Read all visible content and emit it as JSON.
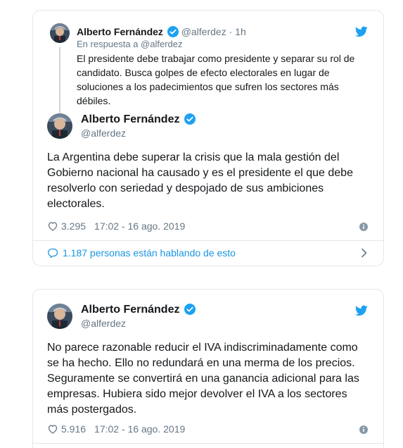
{
  "tweets": [
    {
      "reply_parent": {
        "author_name": "Alberto Fernández",
        "handle": "@alferdez",
        "separator": "·",
        "time_ago": "1h",
        "reply_label": "En respuesta a @alferdez",
        "text": "El presidente debe trabajar como presidente y separar su rol de candidato. Busca golpes de efecto electorales en lugar de soluciones a los padecimientos que sufren los sectores más débiles."
      },
      "author_name": "Alberto Fernández",
      "handle": "@alferdez",
      "text": "La Argentina debe superar la crisis que la mala gestión del Gobierno nacional ha causado y es el presidente el que debe resolverlo con seriedad y despojado de sus ambiciones electorales.",
      "likes": "3.295",
      "timestamp": "17:02 - 16 ago. 2019",
      "conversation": "1.187 personas están hablando de esto"
    },
    {
      "author_name": "Alberto Fernández",
      "handle": "@alferdez",
      "text": "No parece razonable reducir el IVA indiscriminadamente como se ha hecho. Ello no redundará en una merma de los precios. Seguramente se convertirá en una ganancia adicional para las empresas. Hubiera sido mejor devolver el IVA a los sectores más postergados.",
      "likes": "5.916",
      "timestamp": "17:02 - 16 ago. 2019"
    }
  ],
  "colors": {
    "twitter_blue": "#1da1f2",
    "link_blue": "#1b95e0",
    "text": "#14171a",
    "muted": "#657786",
    "border": "#e1e8ed"
  },
  "icons": [
    "twitter-bird-icon",
    "verified-badge-icon",
    "heart-icon",
    "info-icon",
    "reply-bubble-icon",
    "chevron-right-icon"
  ]
}
